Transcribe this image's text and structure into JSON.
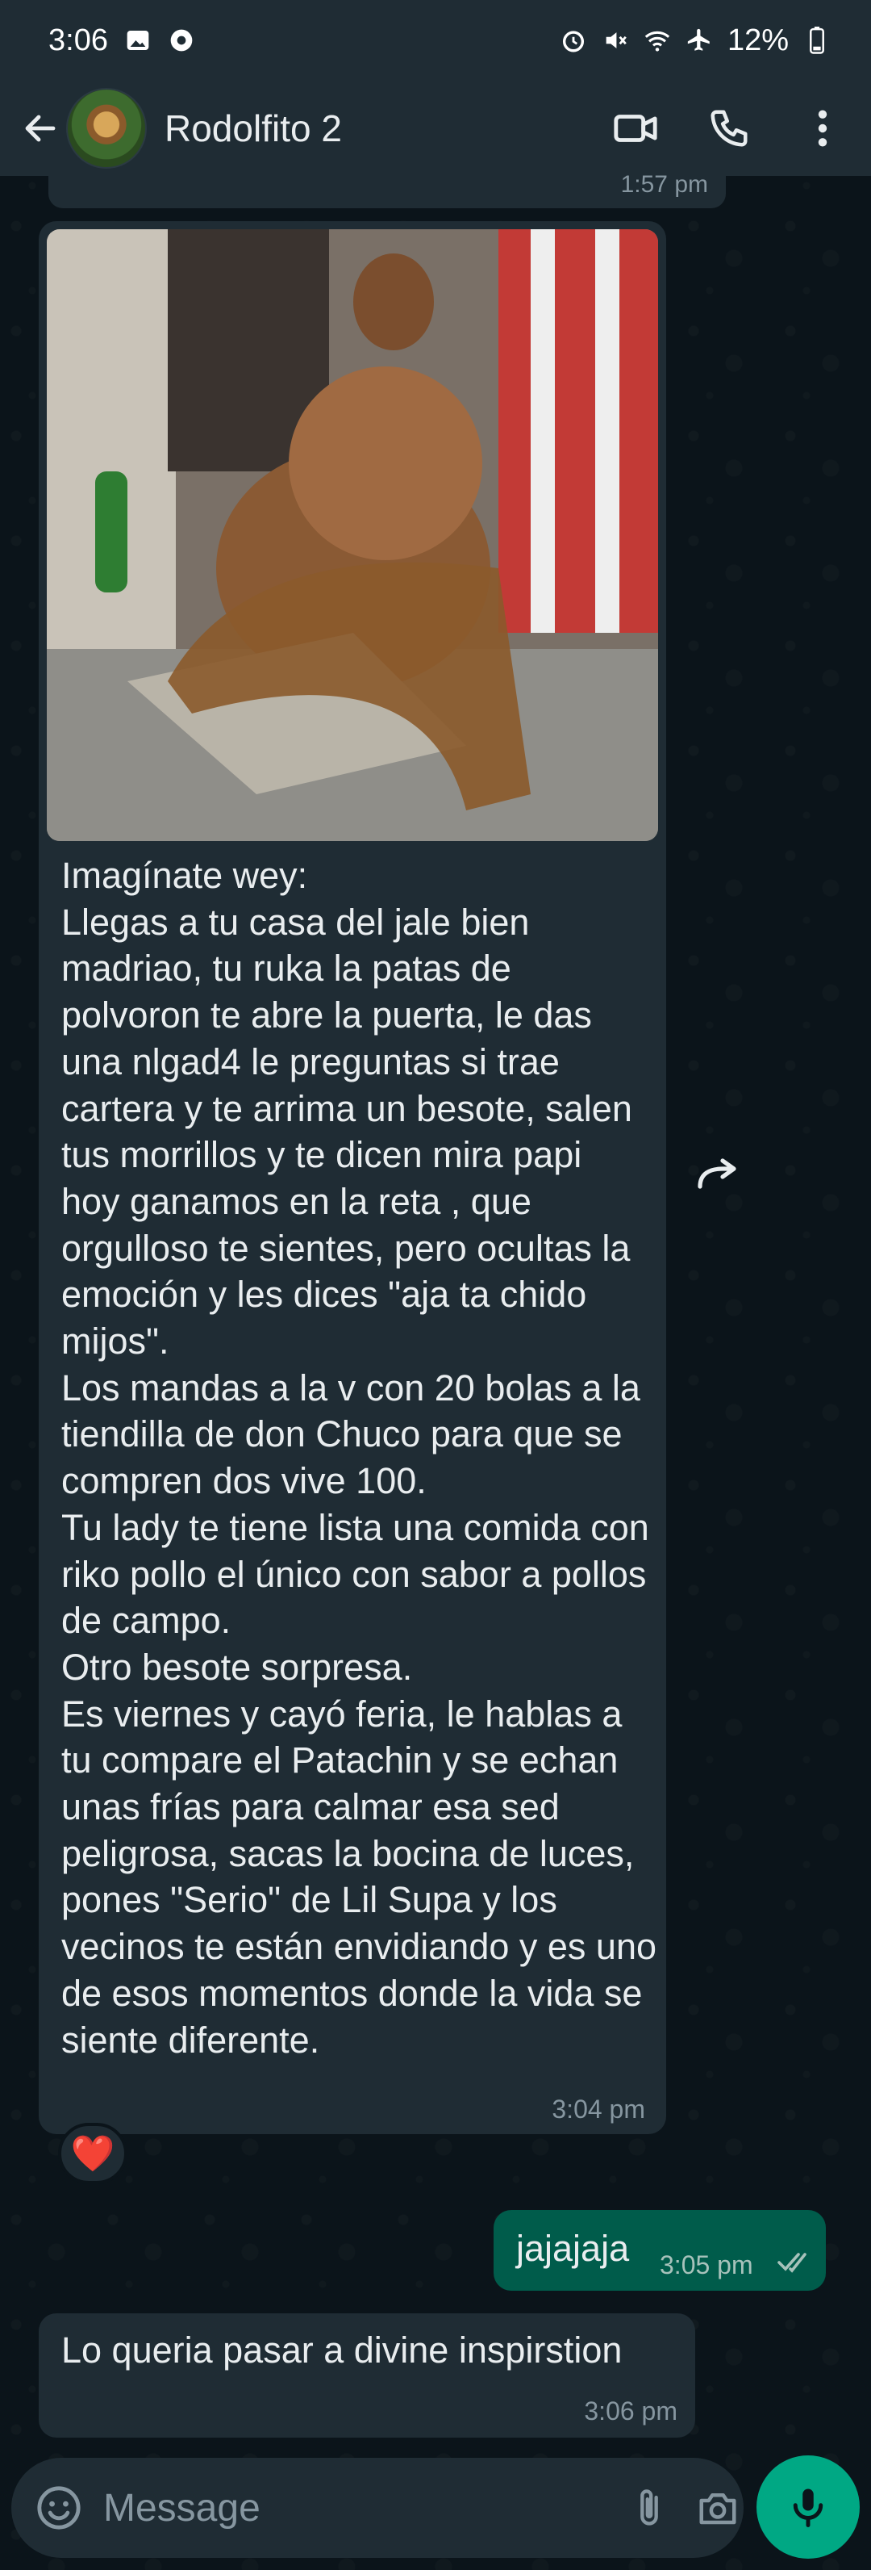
{
  "status_bar": {
    "time": "3:06",
    "battery": "12%",
    "left_icons": [
      "gallery-icon",
      "chrome-icon"
    ],
    "right_icons": [
      "alarm-icon",
      "mute-icon",
      "wifi-icon",
      "airplane-icon",
      "battery-icon"
    ]
  },
  "header": {
    "contact_name": "Rodolfito 2",
    "icons": [
      "back-arrow-icon",
      "avatar",
      "video-call-icon",
      "phone-icon",
      "menu-icon"
    ]
  },
  "messages": {
    "clipped_time": "1:57 pm",
    "incoming_1": {
      "has_image": true,
      "text": "Imagínate wey:\nLlegas a tu casa del jale bien madriao, tu ruka la patas de polvoron te abre la puerta, le das una nlgad4 le preguntas si trae cartera y te arrima un besote, salen tus morrillos y te dicen mira papi  hoy ganamos en la reta , que orgulloso te sientes, pero ocultas la emoción y les dices \"aja ta chido mijos\".\nLos mandas a la v con 20 bolas a la tiendilla de don Chuco para que se compren dos vive 100.\nTu lady te tiene lista una comida con riko pollo el único con sabor a pollos de campo.\nOtro besote sorpresa.\nEs viernes y cayó feria, le hablas a tu compare el Patachin y se echan unas frías para calmar esa sed peligrosa, sacas la bocina de luces, pones \"Serio\" de Lil Supa y los vecinos te están envidiando y es uno de esos momentos donde la vida se siente diferente.",
      "time": "3:04 pm",
      "reaction": "❤️"
    },
    "outgoing_1": {
      "text": "jajajaja",
      "time": "3:05 pm",
      "status": "read"
    },
    "incoming_2": {
      "text": "Lo queria pasar a divine inspirstion",
      "time": "3:06 pm"
    }
  },
  "input_bar": {
    "placeholder": "Message",
    "icons": [
      "emoji-icon",
      "attach-icon",
      "camera-icon",
      "mic-icon"
    ]
  },
  "colors": {
    "background": "#0b141a",
    "bubble_incoming": "#1f2c34",
    "bubble_outgoing": "#005c4b",
    "accent": "#00a884",
    "secondary_text": "#8696a0"
  }
}
